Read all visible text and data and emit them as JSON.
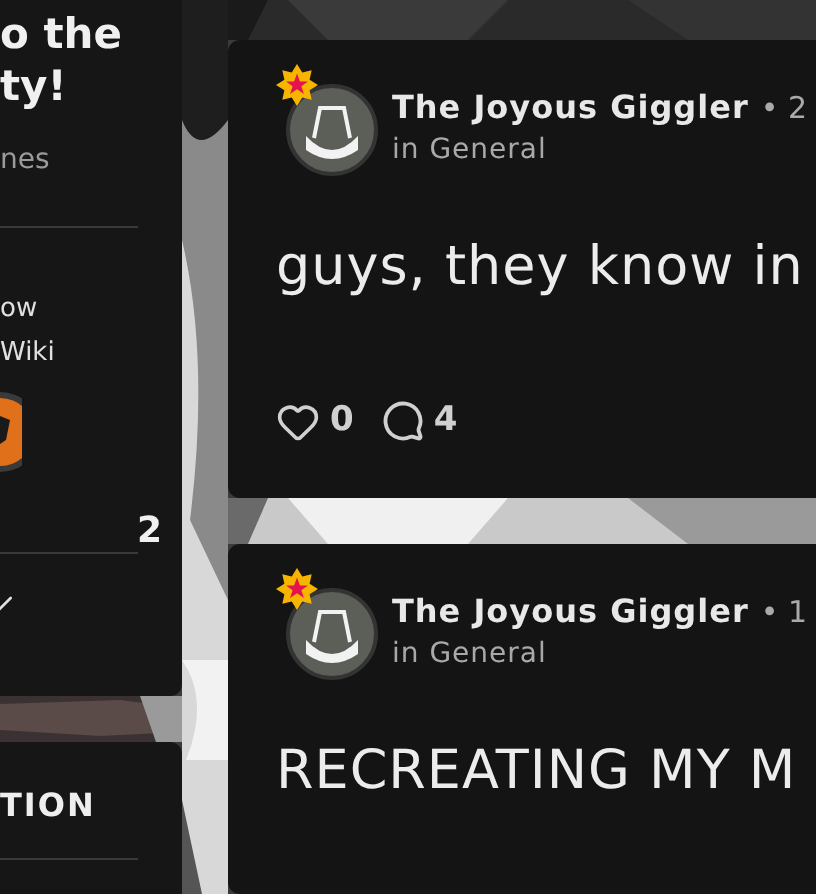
{
  "left_panel": {
    "title_lines": [
      "o the",
      "ty!"
    ],
    "subtitle": "nes",
    "text_lines": [
      "ow",
      "Wiki"
    ],
    "count": "2"
  },
  "lower_panel": {
    "heading": "TION"
  },
  "posts": [
    {
      "author": "The Joyous Giggler",
      "timestamp": "• 2",
      "category": "in General",
      "body": "guys, they know in",
      "likes": "0",
      "comments": "4"
    },
    {
      "author": "The Joyous Giggler",
      "timestamp": "• 1",
      "category": "in General",
      "body": "RECREATING MY M"
    }
  ]
}
